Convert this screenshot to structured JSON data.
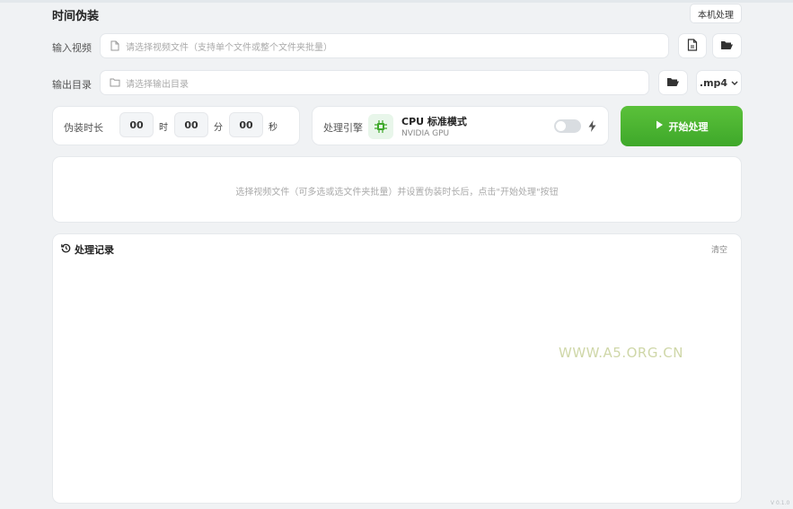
{
  "header": {
    "title": "时间伪装",
    "local_button": "本机处理"
  },
  "input_row": {
    "label": "输入视频",
    "placeholder": "请选择视频文件（支持单个文件或整个文件夹批量）",
    "file_icon": "file-icon",
    "folder_icon": "folder-open-icon"
  },
  "output_row": {
    "label": "输出目录",
    "placeholder": "请选择输出目录",
    "folder_icon": "folder-icon",
    "format_value": ".mp4"
  },
  "duration": {
    "label": "伪装时长",
    "hours": "00",
    "hours_unit": "时",
    "minutes": "00",
    "minutes_unit": "分",
    "seconds": "00",
    "seconds_unit": "秒"
  },
  "engine": {
    "label": "处理引擎",
    "mode_title": "CPU 标准模式",
    "gpu_name": "NVIDIA GPU",
    "toggle_on": false,
    "bolt_icon": "lightning-icon"
  },
  "start_button": {
    "label": "开始处理",
    "icon": "play-icon"
  },
  "hint_text": "选择视频文件（可多选或选文件夹批量）并设置伪装时长后，点击\"开始处理\"按钮",
  "history": {
    "title": "处理记录",
    "clear_label": "清空",
    "icon": "history-icon"
  },
  "watermark": "WWW.A5.ORG.CN",
  "version": "V 0.1.0",
  "colors": {
    "accent_green": "#4bb52f",
    "chip_bg": "#e8f6ea",
    "page_bg": "#f0f2f4"
  }
}
